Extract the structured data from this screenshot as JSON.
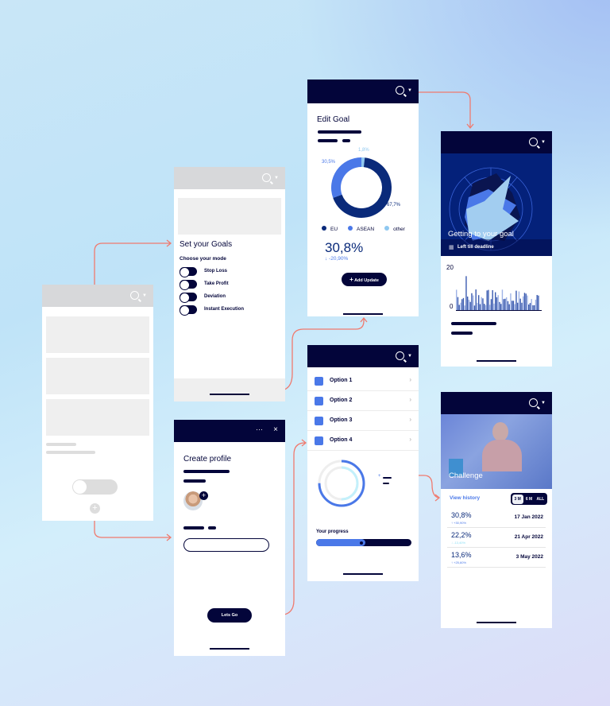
{
  "colors": {
    "accent": "#4a78e8",
    "dark": "#03053a",
    "arrow": "#f07a6e",
    "eu": "#0a2a7a",
    "asean": "#4a78e8",
    "other": "#8fc8f0"
  },
  "set_goals": {
    "title": "Set your Goals",
    "subtitle": "Choose your mode",
    "modes": [
      "Stop Loss",
      "Take Profit",
      "Deviation",
      "Instant Execution"
    ]
  },
  "create_profile": {
    "title": "Create profile",
    "more_icon": "more-horizontal-icon",
    "close_icon": "close-icon",
    "cta": "Lets Go"
  },
  "edit_goal": {
    "title": "Edit Goal",
    "value": "30,8%",
    "change": "↓ -20,90%",
    "button": "Add Update"
  },
  "chart_data": {
    "type": "pie",
    "donut": true,
    "categories": [
      "other",
      "EU",
      "ASEAN"
    ],
    "values": [
      1.8,
      67.7,
      30.5
    ],
    "labels": [
      "1,8%",
      "67,7%",
      "30,5%"
    ],
    "legend": [
      "EU",
      "ASEAN",
      "other"
    ],
    "legend_placement": "bottom"
  },
  "options": {
    "items": [
      "Option 1",
      "Option 2",
      "Option 3",
      "Option 4"
    ],
    "progress_label": "Your progress",
    "progress": 0.52
  },
  "goal": {
    "title": "Getting to your goal",
    "deadline": "Left till deadline",
    "y_max": "20",
    "y_min": "0"
  },
  "challenge": {
    "title": "Challenge",
    "history": "View history",
    "ranges": [
      "3 M",
      "6 M",
      "ALL"
    ],
    "selected_range": "3 M",
    "rows": [
      {
        "value": "30,8%",
        "change": "↑ +30,90%",
        "date": "17 Jan 2022"
      },
      {
        "value": "22,2%",
        "change": "↓ -13,40%",
        "date": "21 Apr 2022"
      },
      {
        "value": "13,6%",
        "change": "↑ +25,60%",
        "date": "3 May 2022"
      }
    ]
  }
}
